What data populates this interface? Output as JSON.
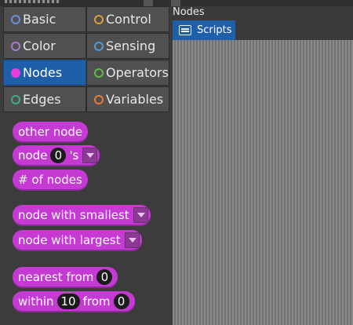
{
  "categories": [
    {
      "label": "Basic",
      "color": "#6c8fd9",
      "selected": false
    },
    {
      "label": "Control",
      "color": "#e09a3a",
      "selected": false
    },
    {
      "label": "Color",
      "color": "#a57bd0",
      "selected": false
    },
    {
      "label": "Sensing",
      "color": "#4f9bd6",
      "selected": false
    },
    {
      "label": "Nodes",
      "color": "#e63ed9",
      "selected": true
    },
    {
      "label": "Operators",
      "color": "#5fb84c",
      "selected": false
    },
    {
      "label": "Edges",
      "color": "#3fae86",
      "selected": false
    },
    {
      "label": "Variables",
      "color": "#ea7a34",
      "selected": false
    }
  ],
  "blocks": {
    "other_node": "other node",
    "node_prefix": "node",
    "node_index": "0",
    "node_suffix": "'s",
    "num_nodes": "# of nodes",
    "node_smallest": "node with smallest",
    "node_largest": "node with largest",
    "nearest_from": "nearest from",
    "nearest_value": "0",
    "within": "within",
    "within_value": "10",
    "from": "from",
    "from_value": "0"
  },
  "sprite": {
    "name": "Nodes"
  },
  "tabs": {
    "scripts": "Scripts"
  },
  "colors": {
    "accent": "#1f5ea8",
    "nodes_block": "#c43ad3"
  }
}
